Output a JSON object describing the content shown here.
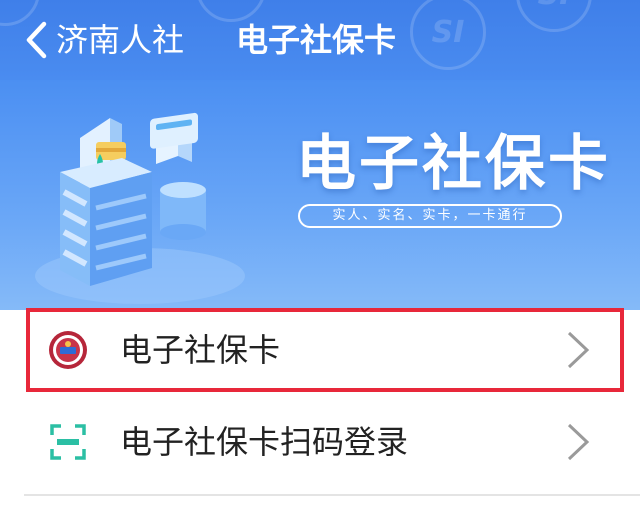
{
  "nav": {
    "back_label": "济南人社",
    "title": "电子社保卡",
    "watermark_text": "SI"
  },
  "banner": {
    "title": "电子社保卡",
    "slogan": "实人、实名、实卡，一卡通行"
  },
  "menu": {
    "items": [
      {
        "label": "电子社保卡",
        "icon": "social-security-emblem-icon",
        "highlighted": true
      },
      {
        "label": "电子社保卡扫码登录",
        "icon": "qr-scan-icon",
        "highlighted": false
      }
    ]
  },
  "colors": {
    "nav_blue": "#4586ee",
    "highlight_red": "#e8283a",
    "scan_green": "#2bbfa4"
  }
}
